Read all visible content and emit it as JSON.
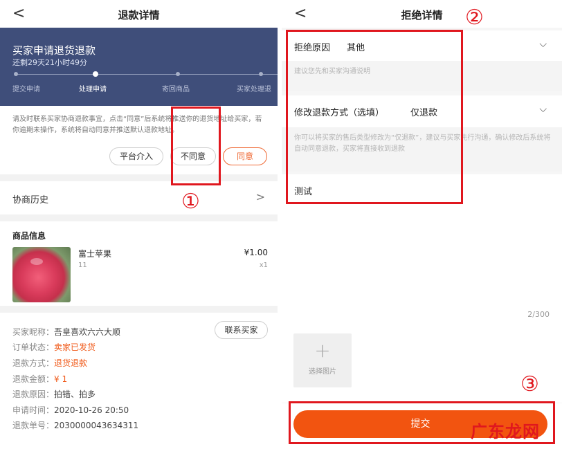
{
  "left": {
    "nav": {
      "back_glyph": "<",
      "title": "退款详情"
    },
    "banner": {
      "title": "买家申请退货退款",
      "countdown": "还剩29天21小时49分",
      "steps": [
        "提交申请",
        "处理申请",
        "寄回商品",
        "买家处理退"
      ],
      "active_step": 2
    },
    "notice": "请及时联系买家协商退款事宜，点击“同意”后系统将推送你的退货地址给买家，若你逾期未操作，系统将自动同意并推送默认退款地址。",
    "buttons": {
      "platform": "平台介入",
      "disagree": "不同意",
      "agree": "同意"
    },
    "history": {
      "label": "协商历史",
      "chevron": ">"
    },
    "goods": {
      "section_title": "商品信息",
      "name": "富士苹果",
      "spec": "11",
      "price": "¥1.00",
      "qty": "x1"
    },
    "info": {
      "contact_button": "联系买家",
      "rows": [
        {
          "key": "买家昵称：",
          "value": "吾皇喜欢六六大顺",
          "orange": false
        },
        {
          "key": "订单状态：",
          "value": "卖家已发货",
          "orange": true
        },
        {
          "key": "退款方式：",
          "value": "退货退款",
          "orange": true
        },
        {
          "key": "退款金额：",
          "value": "¥ 1",
          "orange": true
        },
        {
          "key": "退款原因：",
          "value": "拍错、拍多",
          "orange": false
        },
        {
          "key": "申请时间：",
          "value": "2020-10-26 20:50",
          "orange": false
        },
        {
          "key": "退款单号：",
          "value": "2030000043634311",
          "orange": false
        }
      ]
    }
  },
  "right": {
    "nav": {
      "back_glyph": "<",
      "title": "拒绝详情"
    },
    "reason": {
      "label": "拒绝原因",
      "value": "其他",
      "hint": "建议您先和买家沟通说明"
    },
    "method": {
      "label": "修改退款方式（选填）",
      "value": "仅退款",
      "hint": "你可以将买家的售后类型修改为“仅退款”，建议与买家先行沟通，确认修改后系统将自动同意退款，买家将直接收到退款"
    },
    "note": "测试",
    "counter": "2/300",
    "upload": {
      "plus": "+",
      "label": "选择图片"
    },
    "submit": "提交"
  },
  "annotations": {
    "one": "①",
    "two": "②",
    "three": "③",
    "color": "#e0171e"
  },
  "watermark": "广东龙网",
  "colors": {
    "banner": "#3f4e7a",
    "accent": "#f25410",
    "status_orange": "#f05a1a"
  }
}
